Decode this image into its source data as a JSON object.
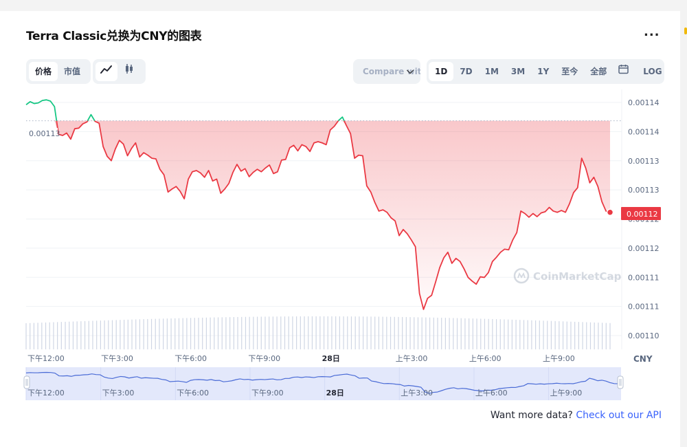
{
  "title": "Terra Classic兑换为CNY的图表",
  "more_label": "...",
  "metric_tabs": [
    {
      "label": "价格",
      "active": true
    },
    {
      "label": "市值",
      "active": false
    }
  ],
  "chart_style_tabs": [
    {
      "icon": "line-chart-icon",
      "active": true
    },
    {
      "icon": "candlestick-icon",
      "active": false
    }
  ],
  "compare_label": "Compare with",
  "range_tabs": [
    {
      "label": "1D",
      "active": true
    },
    {
      "label": "7D",
      "active": false
    },
    {
      "label": "1M",
      "active": false
    },
    {
      "label": "3M",
      "active": false
    },
    {
      "label": "1Y",
      "active": false
    },
    {
      "label": "至今",
      "active": false
    },
    {
      "label": "全部",
      "active": false
    }
  ],
  "calendar_icon": "calendar-icon",
  "log_label": "LOG",
  "watermark": "CoinMarketCap",
  "currency_label": "CNY",
  "colors": {
    "up": "#16c784",
    "down": "#ea3943",
    "nav_line": "#4a6bd6",
    "nav_fill": "#e3e8fb",
    "volume": "#cfd6e4"
  },
  "api_text": "Want more data?",
  "api_link": "Check out our API",
  "chart_data": {
    "type": "line",
    "title": "",
    "xlabel": "",
    "ylabel": "",
    "x_ticks": [
      "下午12:00",
      "下午3:00",
      "下午6:00",
      "下午9:00",
      "28日",
      "上午3:00",
      "上午6:00",
      "上午9:00"
    ],
    "x_range_hours": [
      0,
      23.8
    ],
    "y_ticks": [
      "0.00114",
      "0.00114",
      "0.00113",
      "0.00113",
      "0.00112",
      "0.00112",
      "0.00111",
      "0.00111",
      "0.00110"
    ],
    "ylim": [
      0.0011025,
      0.0011448
    ],
    "reference_label": "0.00113",
    "reference_value": 0.0011397,
    "current_label": "0.00112",
    "series": [
      {
        "values": [
          0.0011423,
          0.0011428,
          0.0011425,
          0.0011426,
          0.001143,
          0.0011431,
          0.0011429,
          0.001142,
          0.0011375,
          0.0011373,
          0.0011377,
          0.0011367,
          0.0011384,
          0.0011385,
          0.0011392,
          0.0011395,
          0.0011407,
          0.0011396,
          0.0011393,
          0.0011355,
          0.0011339,
          0.0011332,
          0.0011351,
          0.0011365,
          0.0011359,
          0.001134,
          0.0011352,
          0.0011361,
          0.0011338,
          0.0011345,
          0.0011341,
          0.0011336,
          0.0011335,
          0.0011318,
          0.0011309,
          0.0011281,
          0.0011286,
          0.001129,
          0.0011282,
          0.001127,
          0.0011302,
          0.0011314,
          0.0011316,
          0.0011312,
          0.0011305,
          0.0011316,
          0.0011299,
          0.0011302,
          0.0011279,
          0.0011286,
          0.0011295,
          0.0011313,
          0.0011326,
          0.0011315,
          0.0011319,
          0.0011306,
          0.0011313,
          0.0011318,
          0.0011314,
          0.001132,
          0.0011325,
          0.0011311,
          0.0011314,
          0.0011333,
          0.0011334,
          0.0011353,
          0.0011357,
          0.0011348,
          0.0011358,
          0.0011355,
          0.0011347,
          0.0011361,
          0.0011363,
          0.0011361,
          0.0011358,
          0.0011382,
          0.0011388,
          0.0011397,
          0.0011403,
          0.0011389,
          0.0011376,
          0.0011336,
          0.0011341,
          0.001134,
          0.0011291,
          0.0011281,
          0.0011264,
          0.001125,
          0.0011252,
          0.0011248,
          0.0011239,
          0.0011234,
          0.001121,
          0.001122,
          0.0011213,
          0.0011203,
          0.0011192,
          0.0011116,
          0.001109,
          0.0011108,
          0.0011113,
          0.0011135,
          0.0011158,
          0.0011174,
          0.0011183,
          0.0011165,
          0.0011173,
          0.0011168,
          0.0011156,
          0.0011142,
          0.0011136,
          0.0011131,
          0.0011143,
          0.0011142,
          0.001115,
          0.0011168,
          0.0011175,
          0.0011183,
          0.0011188,
          0.0011187,
          0.0011203,
          0.0011215,
          0.001125,
          0.0011246,
          0.001124,
          0.0011246,
          0.0011241,
          0.0011247,
          0.0011249,
          0.0011256,
          0.001125,
          0.0011248,
          0.0011251,
          0.0011248,
          0.0011262,
          0.001128,
          0.0011288,
          0.0011336,
          0.001132,
          0.0011296,
          0.0011305,
          0.001129,
          0.0011265,
          0.001125,
          0.0011248
        ]
      }
    ],
    "volume_bars_count": 150
  }
}
